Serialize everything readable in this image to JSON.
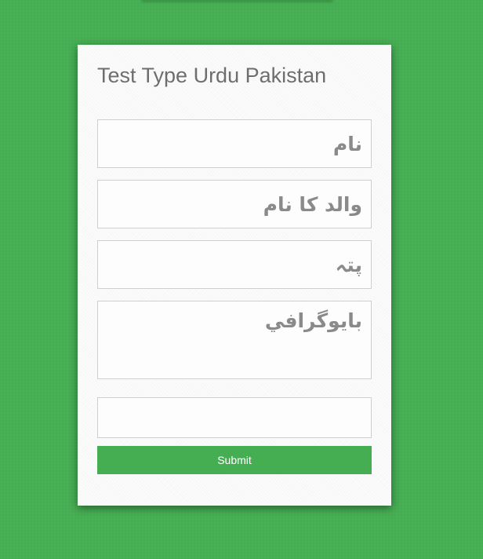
{
  "form": {
    "title": "Test Type Urdu Pakistan",
    "fields": {
      "name": {
        "placeholder": "نام",
        "value": ""
      },
      "father_name": {
        "placeholder": "والد کا نام",
        "value": ""
      },
      "address": {
        "placeholder": "پتہ",
        "value": ""
      },
      "biography": {
        "placeholder": "بايوگرافي",
        "value": ""
      },
      "extra": {
        "placeholder": "",
        "value": ""
      }
    },
    "submit_label": "Submit"
  },
  "colors": {
    "background": "#45ad52",
    "card": "#fbfbfb",
    "accent": "#45ad52",
    "title_text": "#6e6e6e",
    "placeholder_text": "#8a8a8a"
  }
}
